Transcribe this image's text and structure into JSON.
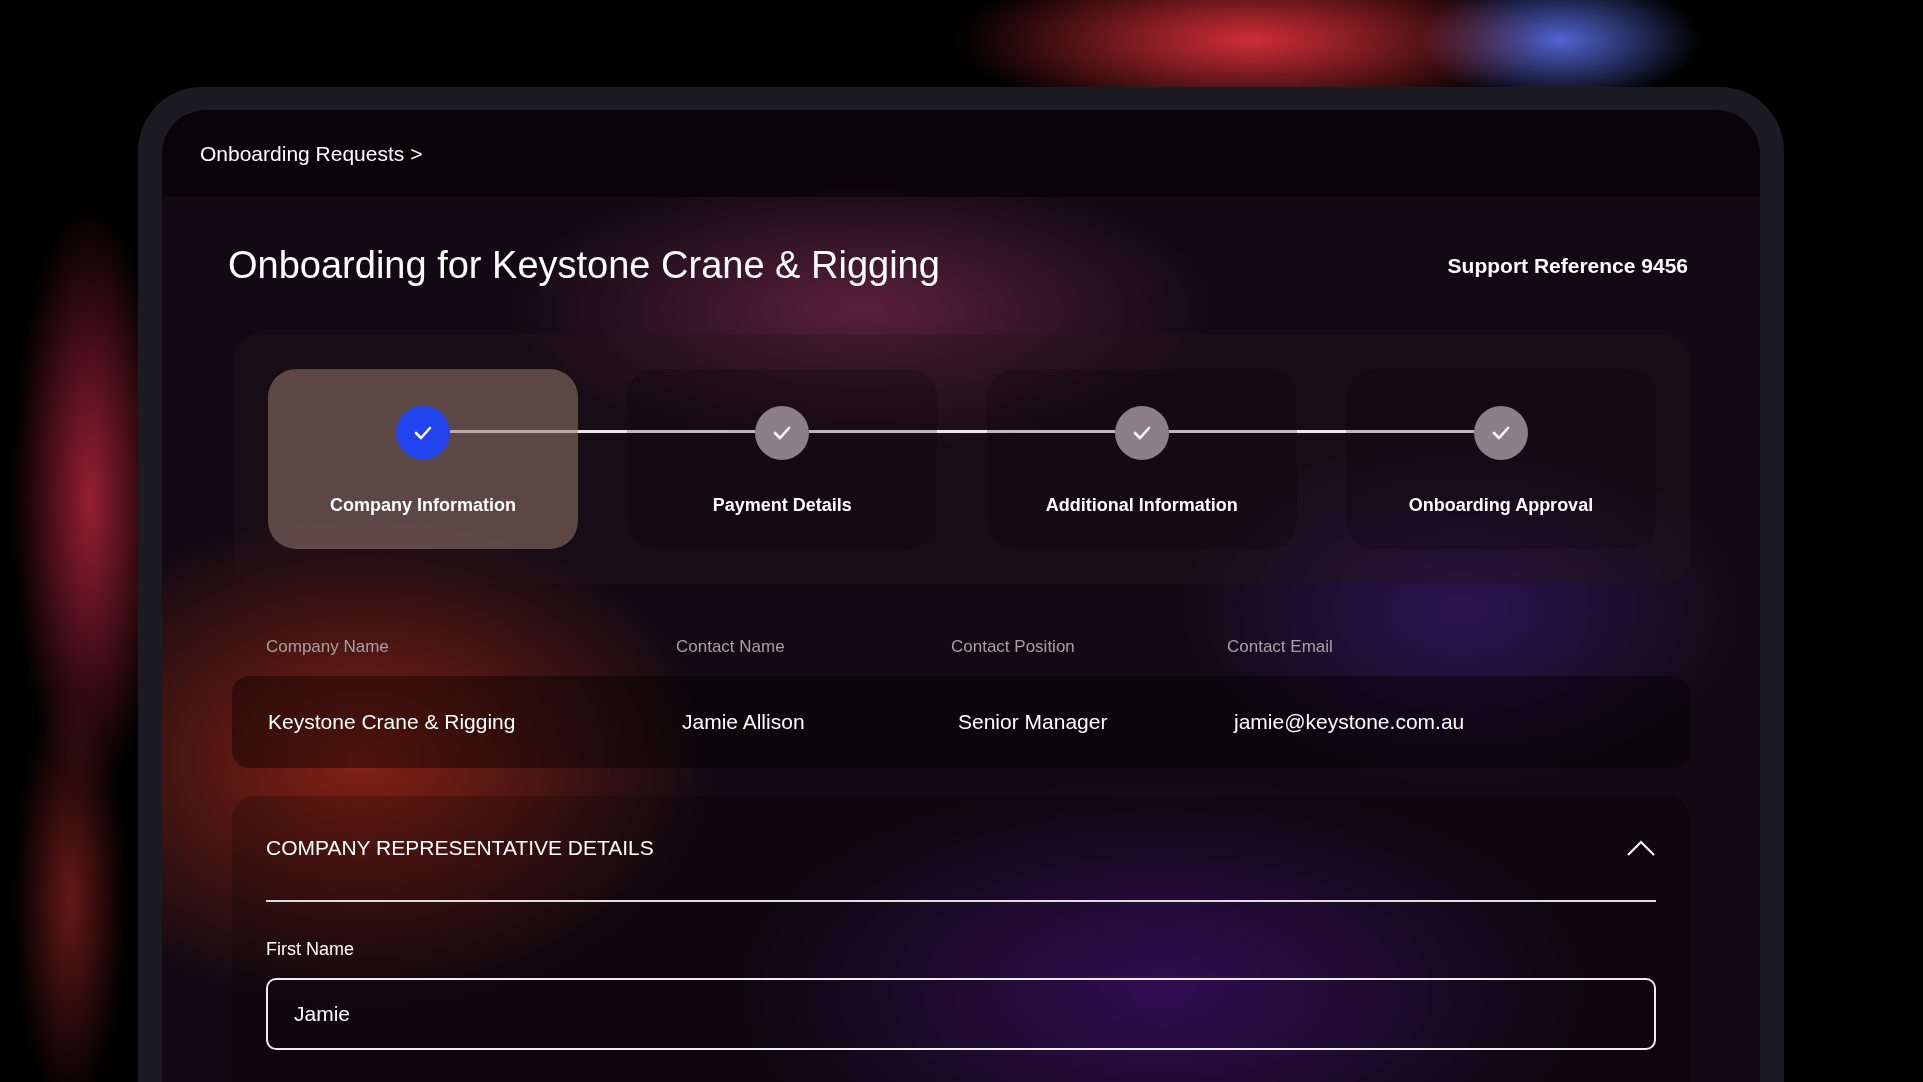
{
  "breadcrumb": "Onboarding Requests >",
  "title": "Onboarding for Keystone Crane & Rigging",
  "support_reference": "Support Reference 9456",
  "steps": [
    {
      "label": "Company Information",
      "selected": true
    },
    {
      "label": "Payment Details",
      "selected": false
    },
    {
      "label": "Additional Information",
      "selected": false
    },
    {
      "label": "Onboarding Approval",
      "selected": false
    }
  ],
  "summary": {
    "columns": [
      "Company Name",
      "Contact Name",
      "Contact Position",
      "Contact Email"
    ],
    "row": [
      "Keystone Crane & Rigging",
      "Jamie Allison",
      "Senior Manager",
      "jamie@keystone.com.au"
    ]
  },
  "section": {
    "title": "COMPANY REPRESENTATIVE DETAILS",
    "expanded": true,
    "fields": [
      {
        "label": "First Name",
        "value": "Jamie"
      }
    ]
  }
}
